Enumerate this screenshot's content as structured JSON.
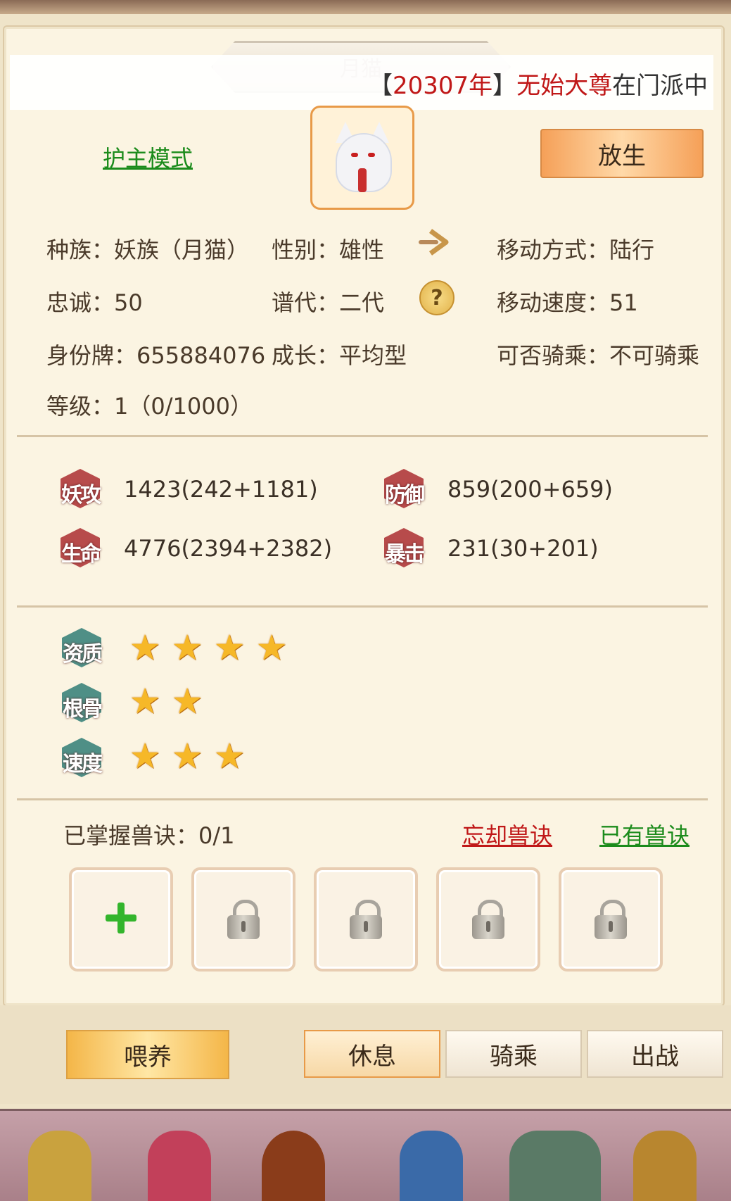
{
  "pet": {
    "name": "月猫",
    "guard_mode_label": "护主模式",
    "release_label": "放生",
    "marquee": {
      "bracket_open": "【",
      "year": "20307年",
      "bracket_close": "】",
      "title": "无始大尊",
      "rest": "在门派中"
    },
    "info": {
      "race": "种族：妖族（月猫）",
      "gender": "性别：雄性",
      "move_type": "移动方式：陆行",
      "loyalty": "忠诚：50",
      "generation": "谱代：二代",
      "move_speed": "移动速度：51",
      "id_tag": "身份牌：655884076",
      "growth": "成长：平均型",
      "rideable": "可否骑乘：不可骑乘",
      "level": "等级：1（0/1000）"
    },
    "stats": [
      {
        "label": "妖攻",
        "value": "1423(242+1181)"
      },
      {
        "label": "防御",
        "value": "859(200+659)"
      },
      {
        "label": "生命",
        "value": "4776(2394+2382)"
      },
      {
        "label": "暴击",
        "value": "231(30+201)"
      }
    ],
    "talents": [
      {
        "label": "资质",
        "stars": 4
      },
      {
        "label": "根骨",
        "stars": 2
      },
      {
        "label": "速度",
        "stars": 3
      }
    ],
    "skills": {
      "count_label": "已掌握兽诀：0/1",
      "forget_label": "忘却兽诀",
      "owned_label": "已有兽诀"
    }
  },
  "actions": {
    "feed": "喂养",
    "rest": "休息",
    "ride": "骑乘",
    "battle": "出战"
  },
  "colors": {
    "accent_orange": "#e89a48",
    "link_green": "#1b8b1b",
    "link_red": "#c01818",
    "star": "#f6b828"
  }
}
